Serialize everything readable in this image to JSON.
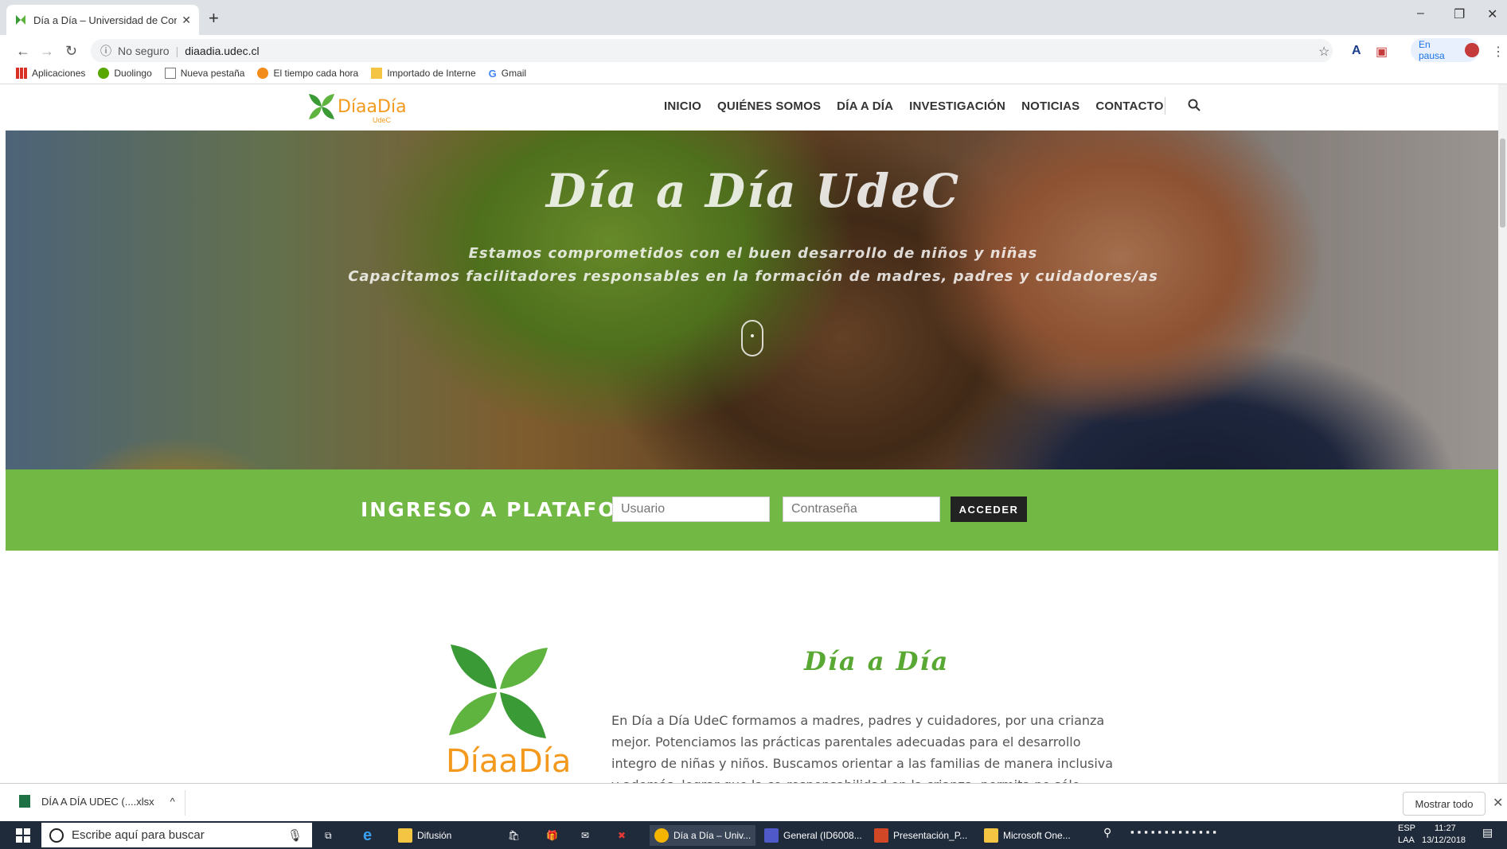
{
  "browser": {
    "tab_title": "Día a Día – Universidad de Conce",
    "new_tab_label": "+",
    "security_label": "No seguro",
    "url": "diaadia.udec.cl",
    "profile_status": "En pausa",
    "bookmarks": [
      {
        "label": "Aplicaciones",
        "icon": "apps-grid-icon"
      },
      {
        "label": "Duolingo",
        "icon": "duolingo-icon"
      },
      {
        "label": "Nueva pestaña",
        "icon": "page-icon"
      },
      {
        "label": "El tiempo cada hora",
        "icon": "weather-icon"
      },
      {
        "label": "Importado de Interne",
        "icon": "folder-icon"
      },
      {
        "label": "Gmail",
        "icon": "google-icon"
      }
    ]
  },
  "site": {
    "logo_text": "DíaaDía",
    "logo_sub": "UdeC",
    "menu": [
      "INICIO",
      "QUIÉNES SOMOS",
      "DÍA A DÍA",
      "INVESTIGACIÓN",
      "NOTICIAS",
      "CONTACTO"
    ],
    "hero": {
      "title": "Día a Día UdeC",
      "line1": "Estamos comprometidos con el buen desarrollo de niños y niñas",
      "line2": "Capacitamos facilitadores responsables en la formación de madres, padres y cuidadores/as"
    },
    "login": {
      "title": "INGRESO A PLATAFORMA",
      "user_placeholder": "Usuario",
      "password_placeholder": "Contraseña",
      "button": "ACCEDER"
    },
    "about": {
      "title": "Día a Día",
      "logo_word": "DíaaDía",
      "text": "En Día a Día UdeC formamos a madres, padres y cuidadores, por una crianza mejor. Potenciamos las prácticas parentales adecuadas para el desarrollo integro de niñas y niños. Buscamos orientar a las familias de manera inclusiva y además, lograr que la co-responsabilidad en la crianza, permita no sólo aportar a la felicidad de nuestros/as"
    },
    "colors": {
      "green": "#72b844",
      "orange": "#f39a1e",
      "dark_green": "#3a9a35"
    }
  },
  "downloads": {
    "file": "DÍA A DÍA UDEC (....xlsx",
    "show_all": "Mostrar todo"
  },
  "taskbar": {
    "search_placeholder": "Escribe aquí para buscar",
    "apps": [
      {
        "label": "Difusión"
      },
      {
        "label": "Día a Día – Univ..."
      },
      {
        "label": "General (ID6008..."
      },
      {
        "label": "Presentación_P..."
      },
      {
        "label": "Microsoft One..."
      }
    ],
    "lang": "ESP",
    "lang_sub": "LAA",
    "time": "11:27",
    "date": "13/12/2018"
  }
}
